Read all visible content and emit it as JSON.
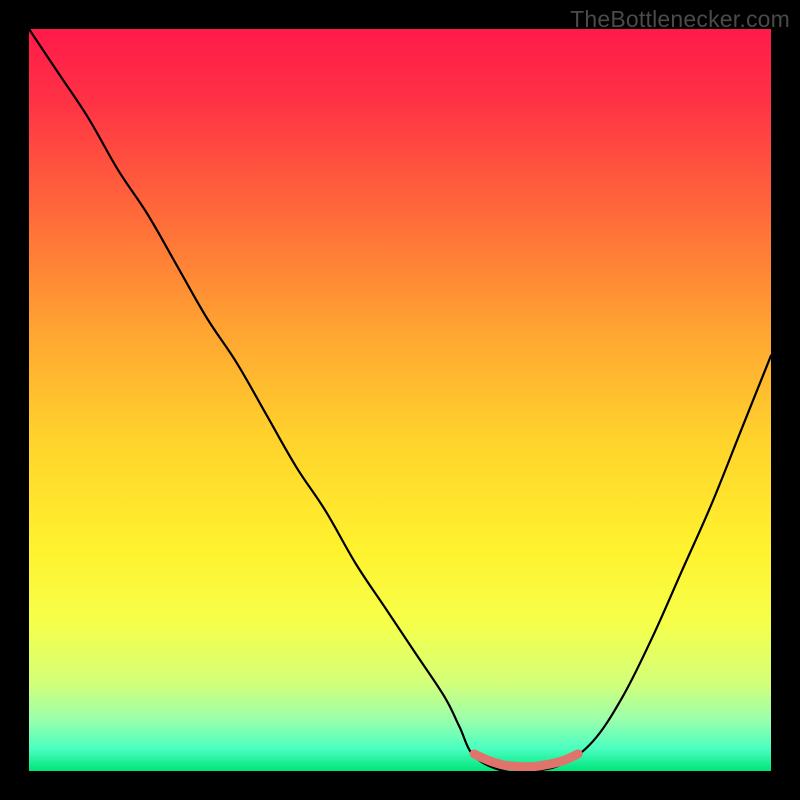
{
  "watermark": "TheBottleneсker.com",
  "colors": {
    "frame": "#000000",
    "curve": "#000000",
    "marker": "#e1736d",
    "watermark": "#4a4a4a"
  },
  "chart_data": {
    "type": "line",
    "title": "",
    "xlabel": "",
    "ylabel": "",
    "xlim": [
      0,
      100
    ],
    "ylim": [
      0,
      100
    ],
    "grid": false,
    "legend": false,
    "background_gradient_stops": [
      {
        "offset": 0.0,
        "color": "#ff1a4a"
      },
      {
        "offset": 0.1,
        "color": "#ff3345"
      },
      {
        "offset": 0.25,
        "color": "#ff6a3a"
      },
      {
        "offset": 0.4,
        "color": "#ffa232"
      },
      {
        "offset": 0.55,
        "color": "#ffd22c"
      },
      {
        "offset": 0.7,
        "color": "#fff22e"
      },
      {
        "offset": 0.8,
        "color": "#f6ff4a"
      },
      {
        "offset": 0.88,
        "color": "#d4ff78"
      },
      {
        "offset": 0.93,
        "color": "#9cffac"
      },
      {
        "offset": 0.97,
        "color": "#4affc0"
      },
      {
        "offset": 1.0,
        "color": "#00e47a"
      }
    ],
    "series": [
      {
        "name": "bottleneck-curve",
        "x": [
          0,
          4,
          8,
          12,
          16,
          20,
          24,
          28,
          32,
          36,
          40,
          44,
          48,
          52,
          56,
          58,
          60,
          64,
          68,
          72,
          76,
          80,
          84,
          88,
          92,
          96,
          100
        ],
        "y": [
          100,
          94,
          88,
          81,
          75,
          68,
          61,
          55,
          48,
          41,
          35,
          28,
          22,
          16,
          10,
          6,
          2,
          0,
          0,
          1,
          4,
          10,
          18,
          27,
          36,
          46,
          56
        ]
      }
    ],
    "highlight_segment": {
      "name": "optimal-range",
      "x": [
        60,
        62,
        64,
        66,
        68,
        70,
        72,
        74
      ],
      "y": [
        2.3,
        1.4,
        0.8,
        0.6,
        0.6,
        0.9,
        1.4,
        2.3
      ]
    }
  }
}
